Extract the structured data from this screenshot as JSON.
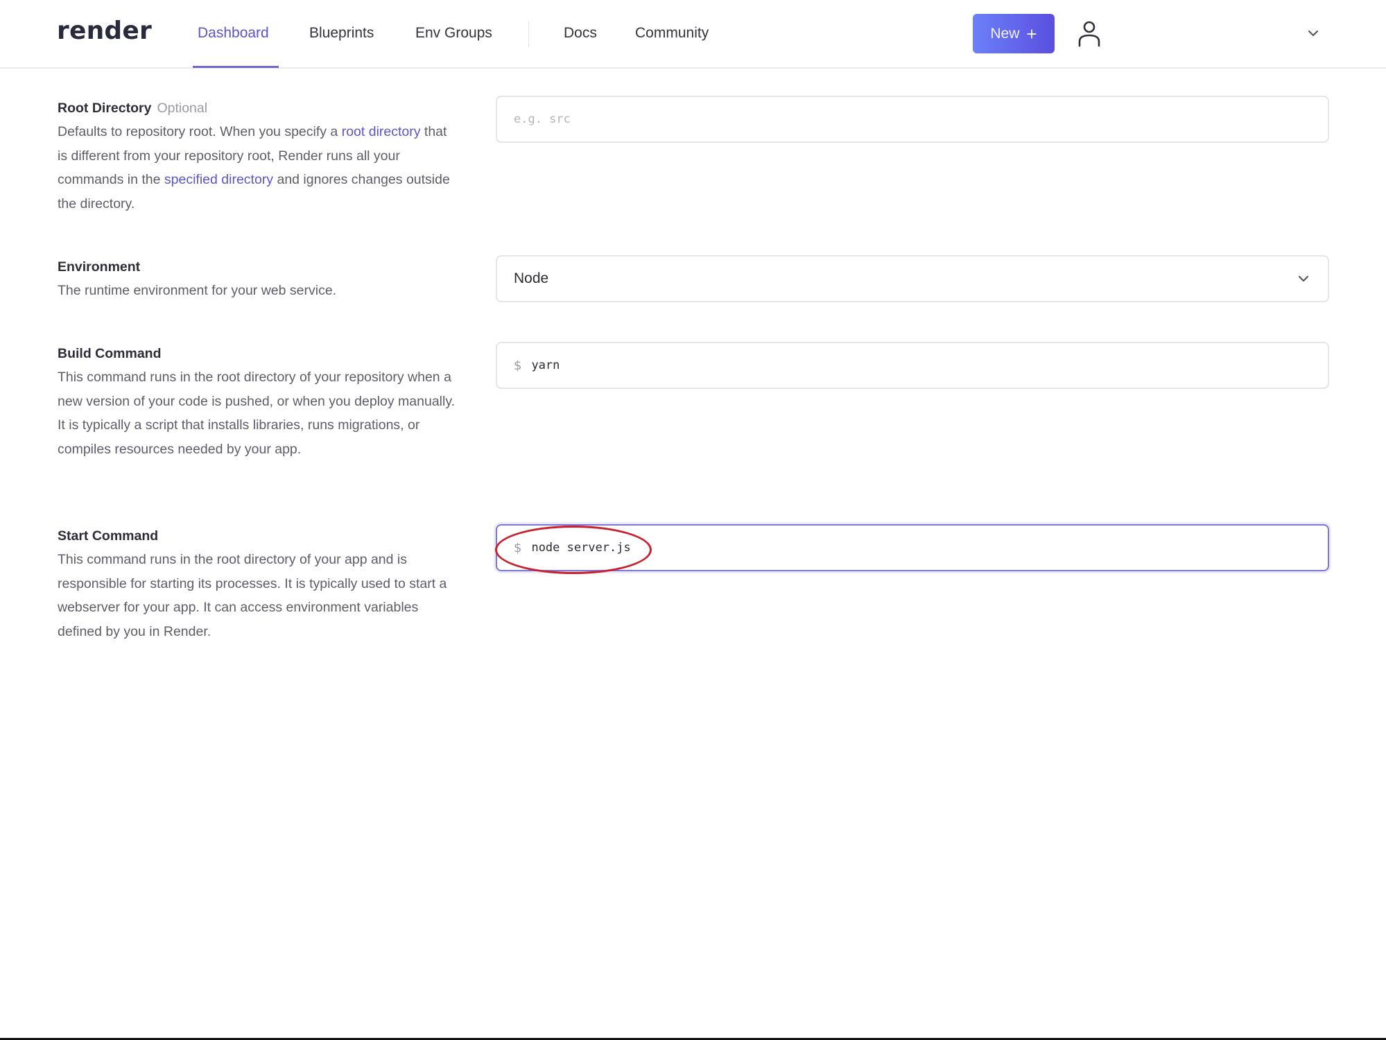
{
  "header": {
    "logo": "render",
    "nav": [
      {
        "label": "Dashboard",
        "active": true
      },
      {
        "label": "Blueprints",
        "active": false
      },
      {
        "label": "Env Groups",
        "active": false
      },
      {
        "label": "Docs",
        "active": false
      },
      {
        "label": "Community",
        "active": false
      }
    ],
    "new_button": {
      "label": "New",
      "icon": "plus-icon"
    },
    "user_icon": "user-icon",
    "account_menu_icon": "chevron-down-icon",
    "accent_color": "#5b55c8"
  },
  "form": {
    "root_directory": {
      "title": "Root Directory",
      "optional_label": "Optional",
      "desc_part1": "Defaults to repository root. When you specify a ",
      "desc_link1": "root directory",
      "desc_part2": " that is different from your repository root, Render runs all your commands in the ",
      "desc_link2": "specified directory",
      "desc_part3": " and ignores changes outside the directory.",
      "placeholder": "e.g. src",
      "value": ""
    },
    "environment": {
      "title": "Environment",
      "description": "The runtime environment for your web service.",
      "selected": "Node"
    },
    "build_command": {
      "title": "Build Command",
      "description": "This command runs in the root directory of your repository when a new version of your code is pushed, or when you deploy manually. It is typically a script that installs libraries, runs migrations, or compiles resources needed by your app.",
      "prefix": "$",
      "value": "yarn"
    },
    "start_command": {
      "title": "Start Command",
      "description": "This command runs in the root directory of your app and is responsible for starting its processes. It is typically used to start a webserver for your app. It can access environment variables defined by you in Render.",
      "prefix": "$",
      "value": "node server.js",
      "focused": true,
      "annotation": "red-ellipse-highlight"
    }
  }
}
